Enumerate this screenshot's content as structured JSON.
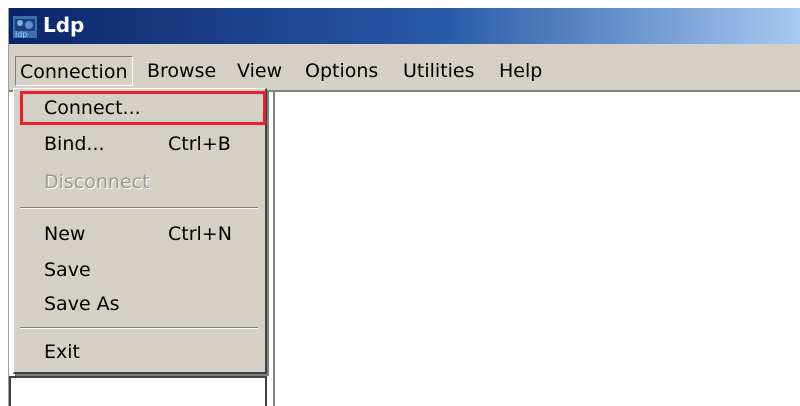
{
  "window": {
    "title": "Ldp",
    "icon": "ldp-app-icon"
  },
  "menubar": {
    "items": [
      {
        "label": "Connection",
        "active": true
      },
      {
        "label": "Browse"
      },
      {
        "label": "View"
      },
      {
        "label": "Options"
      },
      {
        "label": "Utilities"
      },
      {
        "label": "Help"
      }
    ]
  },
  "connection_menu": {
    "items": [
      {
        "label": "Connect...",
        "shortcut": "",
        "enabled": true,
        "highlighted": true
      },
      {
        "label": "Bind...",
        "shortcut": "Ctrl+B",
        "enabled": true
      },
      {
        "label": "Disconnect",
        "shortcut": "",
        "enabled": false
      },
      {
        "label": "New",
        "shortcut": "Ctrl+N",
        "enabled": true
      },
      {
        "label": "Save",
        "shortcut": "",
        "enabled": true
      },
      {
        "label": "Save As",
        "shortcut": "",
        "enabled": true
      },
      {
        "label": "Exit",
        "shortcut": "",
        "enabled": true
      }
    ]
  },
  "colors": {
    "highlight_outline": "#e8202a",
    "titlebar_start": "#0a246a",
    "titlebar_end": "#a6caf0"
  }
}
